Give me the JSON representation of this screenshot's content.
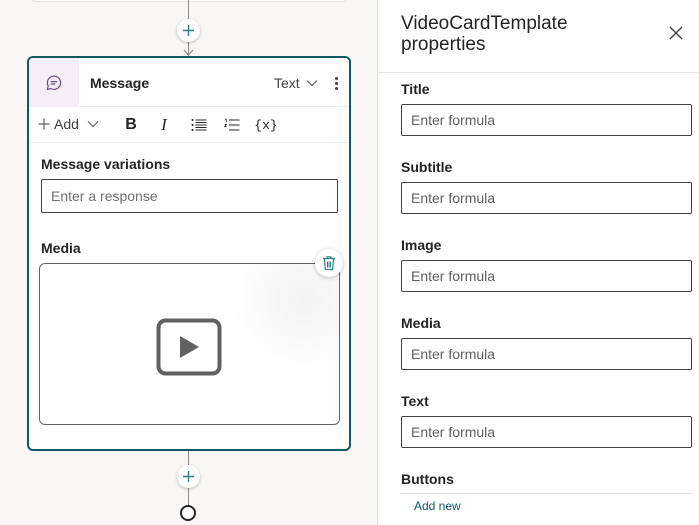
{
  "canvas": {
    "message_card": {
      "title": "Message",
      "type_label": "Text",
      "toolbar": {
        "add_label": "Add",
        "bold_label": "B",
        "italic_label": "I",
        "variable_label": "{x}"
      },
      "variations_label": "Message variations",
      "response_placeholder": "Enter a response",
      "media_label": "Media"
    }
  },
  "panel": {
    "title": "VideoCardTemplate properties",
    "fields": [
      {
        "label": "Title",
        "placeholder": "Enter formula"
      },
      {
        "label": "Subtitle",
        "placeholder": "Enter formula"
      },
      {
        "label": "Image",
        "placeholder": "Enter formula"
      },
      {
        "label": "Media",
        "placeholder": "Enter formula"
      },
      {
        "label": "Text",
        "placeholder": "Enter formula"
      }
    ],
    "buttons_label": "Buttons",
    "add_new_label": "Add new"
  },
  "colors": {
    "accent": "#0f5961",
    "plus_icon": "#2f7f8a",
    "trash_icon": "#2f7f8a",
    "card_icon_bg": "#f3eef7"
  },
  "icons": [
    "plus-icon",
    "chat-icon",
    "chevron-down-icon",
    "more-vertical-icon",
    "bold-icon",
    "italic-icon",
    "bullet-list-icon",
    "numbered-list-icon",
    "variable-icon",
    "play-icon",
    "trash-icon",
    "close-icon"
  ]
}
